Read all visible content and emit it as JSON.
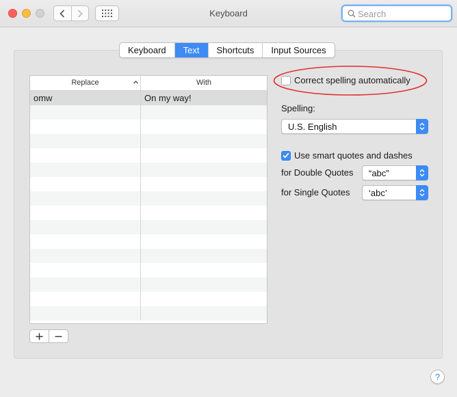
{
  "window": {
    "title": "Keyboard"
  },
  "search": {
    "placeholder": "Search"
  },
  "tabs": [
    {
      "label": "Keyboard",
      "active": false
    },
    {
      "label": "Text",
      "active": true
    },
    {
      "label": "Shortcuts",
      "active": false
    },
    {
      "label": "Input Sources",
      "active": false
    }
  ],
  "table": {
    "headers": {
      "replace": "Replace",
      "with": "With"
    },
    "sort": {
      "column": "Replace",
      "direction": "ascending"
    },
    "rows": [
      {
        "replace": "omw",
        "with": "On my way!"
      }
    ]
  },
  "controls": {
    "add_label": "+",
    "remove_label": "−"
  },
  "options": {
    "correct_spelling": {
      "label": "Correct spelling automatically",
      "checked": false
    },
    "spelling_label": "Spelling:",
    "spelling_value": "U.S. English",
    "smart_quotes": {
      "label": "Use smart quotes and dashes",
      "checked": true
    },
    "double_quotes_label": "for Double Quotes",
    "double_quotes_value": "“abc”",
    "single_quotes_label": "for Single Quotes",
    "single_quotes_value": "‘abc’"
  },
  "help": {
    "label": "?"
  },
  "colors": {
    "accent": "#3d8bf5",
    "highlight_annotation": "#e0312f"
  }
}
